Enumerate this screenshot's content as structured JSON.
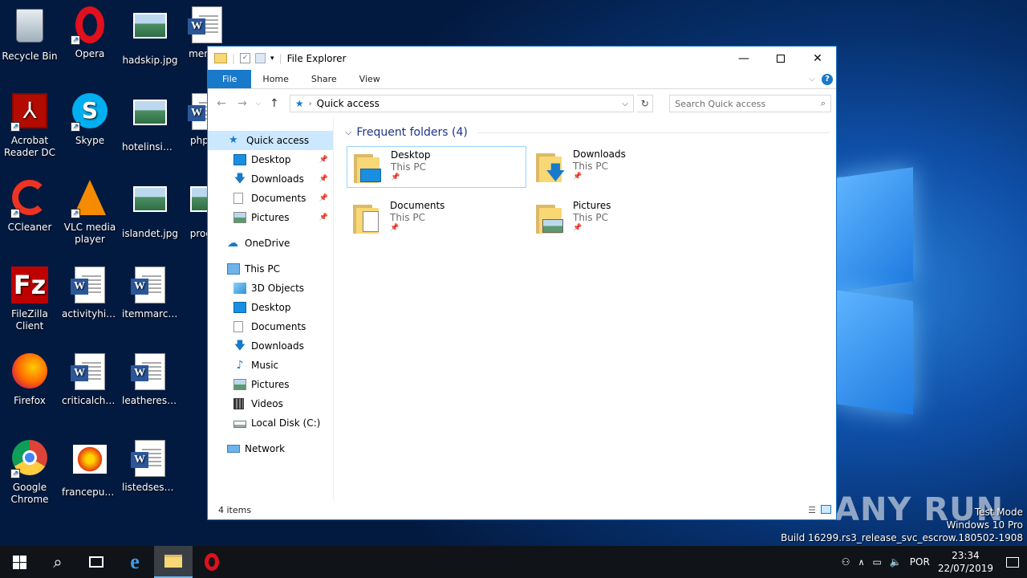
{
  "desktop": {
    "icons": [
      {
        "label": "Recycle Bin"
      },
      {
        "label": "Opera"
      },
      {
        "label": "hadskip.jpg"
      },
      {
        "label": "menu..."
      },
      {
        "label": "Acrobat Reader DC"
      },
      {
        "label": "Skype"
      },
      {
        "label": "hotelinside...."
      },
      {
        "label": "phpd..."
      },
      {
        "label": "CCleaner"
      },
      {
        "label": "VLC media player"
      },
      {
        "label": "islandet.jpg"
      },
      {
        "label": "progr..."
      },
      {
        "label": "FileZilla Client"
      },
      {
        "label": "activityhits...."
      },
      {
        "label": "itemmarch...."
      },
      {
        "label": "Firefox"
      },
      {
        "label": "criticalchu...."
      },
      {
        "label": "leatheresta...."
      },
      {
        "label": "Google Chrome"
      },
      {
        "label": "francepurp...."
      },
      {
        "label": "listedsessio...."
      }
    ]
  },
  "window": {
    "title": "File Explorer",
    "ribbon_tabs": [
      "File",
      "Home",
      "Share",
      "View"
    ],
    "address": "Quick access",
    "search_placeholder": "Search Quick access",
    "nav": {
      "quick_access": "Quick access",
      "qa_items": [
        "Desktop",
        "Downloads",
        "Documents",
        "Pictures"
      ],
      "onedrive": "OneDrive",
      "this_pc": "This PC",
      "pc_items": [
        "3D Objects",
        "Desktop",
        "Documents",
        "Downloads",
        "Music",
        "Pictures",
        "Videos",
        "Local Disk (C:)"
      ],
      "network": "Network"
    },
    "group_header": "Frequent folders (4)",
    "tiles": [
      {
        "name": "Desktop",
        "location": "This PC"
      },
      {
        "name": "Downloads",
        "location": "This PC"
      },
      {
        "name": "Documents",
        "location": "This PC"
      },
      {
        "name": "Pictures",
        "location": "This PC"
      }
    ],
    "status": "4 items"
  },
  "taskbar": {
    "language": "POR",
    "time": "23:34",
    "date": "22/07/2019"
  },
  "watermark": {
    "line1": "Test Mode",
    "line2": "Windows 10 Pro",
    "line3": "Build 16299.rs3_release_svc_escrow.180502-1908",
    "brand": "ANY RUN"
  },
  "colors": {
    "accent": "#1979ca",
    "selection": "#cce8ff",
    "folder": "#f8d775"
  }
}
